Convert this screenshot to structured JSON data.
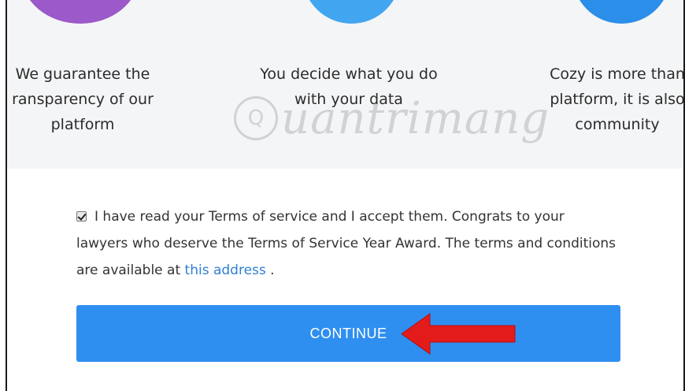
{
  "features": [
    {
      "lines": [
        "We guarantee the",
        "ransparency of our",
        "platform"
      ],
      "color": "#9b59c9"
    },
    {
      "lines": [
        "You decide what you do",
        "with your data"
      ],
      "color": "#42a5f0"
    },
    {
      "lines": [
        "Cozy is more than",
        "platform, it is also",
        "community"
      ],
      "color": "#2b8ee8"
    }
  ],
  "watermark": {
    "text": "uantrimang",
    "badge": "Q"
  },
  "terms": {
    "checked": true,
    "text": "I have read your Terms of service and I accept them. Congrats to your lawyers who deserve the Terms of Service Year Award. The terms and conditions are available at",
    "link_text": "this address",
    "suffix": " ."
  },
  "continue_label": "CONTINUE",
  "colors": {
    "accent": "#2f8ff0",
    "arrow": "#e31b1b",
    "link": "#2f7fd3"
  }
}
